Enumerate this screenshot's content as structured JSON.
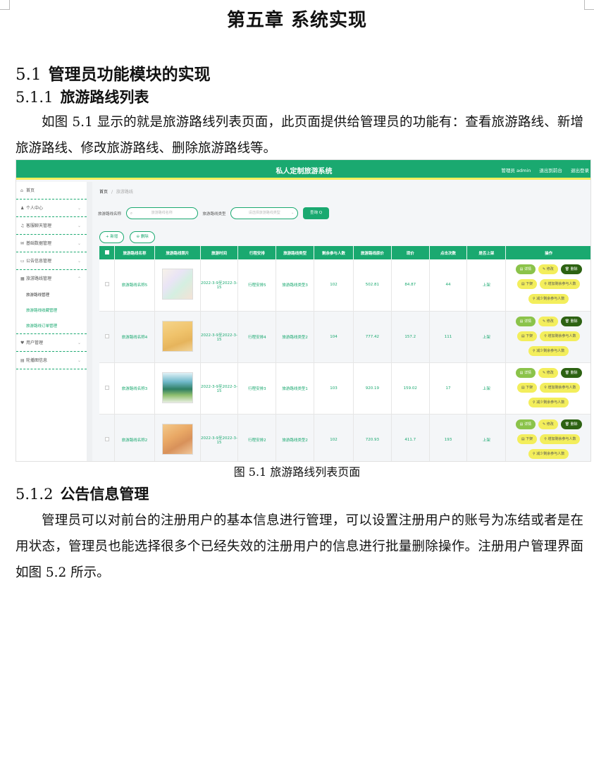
{
  "chapter_title": "第五章  系统实现",
  "section": {
    "num": "5.1",
    "title": "管理员功能模块的实现"
  },
  "sub1": {
    "num": "5.1.1",
    "title": "旅游路线列表"
  },
  "para1": "如图 5.1 显示的就是旅游路线列表页面，此页面提供给管理员的功能有：查看旅游路线、新增旅游路线、修改旅游路线、删除旅游路线等。",
  "figure_caption": "图 5.1  旅游路线列表页面",
  "sub2": {
    "num": "5.1.2",
    "title": "公告信息管理"
  },
  "para2": "管理员可以对前台的注册用户的基本信息进行管理，可以设置注册用户的账号为冻结或者是在用状态，管理员也能选择很多个已经失效的注册用户的信息进行批量删除操作。注册用户管理界面如图 5.2 所示。",
  "screenshot": {
    "system_title": "私人定制旅游系统",
    "topbar_links": [
      "管理员 admin",
      "退出到前台",
      "退出登录"
    ],
    "sidebar": {
      "items": [
        {
          "icon": "⌂",
          "label": "首页"
        },
        {
          "icon": "♟",
          "label": "个人中心"
        },
        {
          "icon": "♫",
          "label": "客服聊天管理"
        },
        {
          "icon": "✉",
          "label": "基础数据管理"
        },
        {
          "icon": "▭",
          "label": "公告信息管理"
        },
        {
          "icon": "▦",
          "label": "旅游路线管理"
        }
      ],
      "sub_items": [
        "旅游路线管理",
        "旅游路线收藏管理",
        "旅游路线订单管理"
      ],
      "items_after": [
        {
          "icon": "♥",
          "label": "用户管理"
        },
        {
          "icon": "▤",
          "label": "轮播图信息"
        }
      ]
    },
    "breadcrumb": {
      "home": "首页",
      "separator": "/",
      "current": "旅游路线"
    },
    "search": {
      "name_label": "旅游路线名称",
      "name_placeholder": "旅游路线名称",
      "type_label": "旅游路线类型",
      "type_placeholder": "请选择旅游路线类型",
      "query_button": "查询 Q"
    },
    "actions": {
      "add": "+ 新增",
      "delete": "⊖ 删除"
    },
    "table": {
      "headers": [
        "旅游路线名称",
        "旅游路线照片",
        "旅游时间",
        "行程安排",
        "旅游路线类型",
        "剩余参与人数",
        "旅游路线原价",
        "现价",
        "点击次数",
        "是否上架",
        "操作"
      ],
      "rows": [
        {
          "name": "旅游路线名称5",
          "time": "2022-3-9至2022-3-15",
          "schedule": "行程安排5",
          "type": "旅游路线类型3",
          "remain": "102",
          "orig_price": "502.81",
          "price": "84.87",
          "clicks": "44",
          "status": "上架"
        },
        {
          "name": "旅游路线名称4",
          "time": "2022-3-9至2022-3-15",
          "schedule": "行程安排4",
          "type": "旅游路线类型2",
          "remain": "104",
          "orig_price": "777.42",
          "price": "157.2",
          "clicks": "111",
          "status": "上架"
        },
        {
          "name": "旅游路线名称3",
          "time": "2022-3-9至2022-3-15",
          "schedule": "行程安排3",
          "type": "旅游路线类型1",
          "remain": "103",
          "orig_price": "920.19",
          "price": "159.02",
          "clicks": "17",
          "status": "上架"
        },
        {
          "name": "旅游路线名称2",
          "time": "2022-3-9至2022-3-15",
          "schedule": "行程安排2",
          "type": "旅游路线类型2",
          "remain": "102",
          "orig_price": "720.93",
          "price": "411.7",
          "clicks": "193",
          "status": "上架"
        }
      ],
      "row_ops": {
        "detail": "▤ 详情",
        "edit": "✎ 修改",
        "delete": "🗑 删除",
        "unlist": "▤ 下架",
        "add_people": "⚲ 增加剩余参与人数",
        "reduce_people": "⚲ 减少剩余参与人数"
      }
    }
  }
}
